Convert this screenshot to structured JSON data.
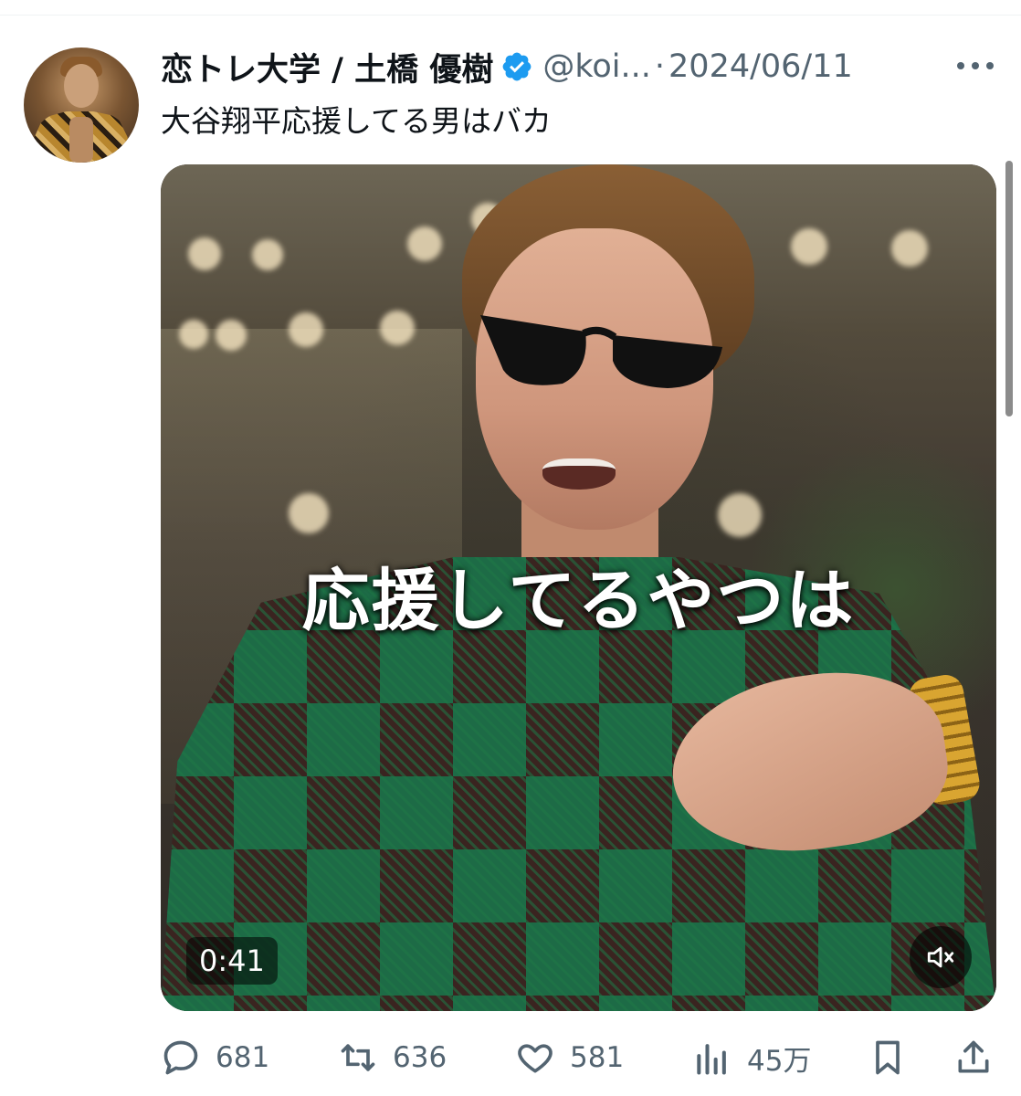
{
  "tweet": {
    "author": {
      "display_name": "恋トレ大学 / 土橋 優樹",
      "handle": "@koi...",
      "verified": true,
      "avatar_icon": "avatar-image"
    },
    "separator": "·",
    "date": "2024/06/11",
    "text": "大谷翔平応援してる男はバカ",
    "media": {
      "type": "video",
      "caption": "応援してるやつは",
      "duration": "0:41",
      "mute_icon": "volume-muted-icon"
    },
    "metrics": {
      "replies": "681",
      "retweets": "636",
      "likes": "581",
      "views": "45万"
    }
  },
  "colors": {
    "text_primary": "#0f1419",
    "text_secondary": "#536471",
    "verified_badge": "#1d9bf0"
  }
}
